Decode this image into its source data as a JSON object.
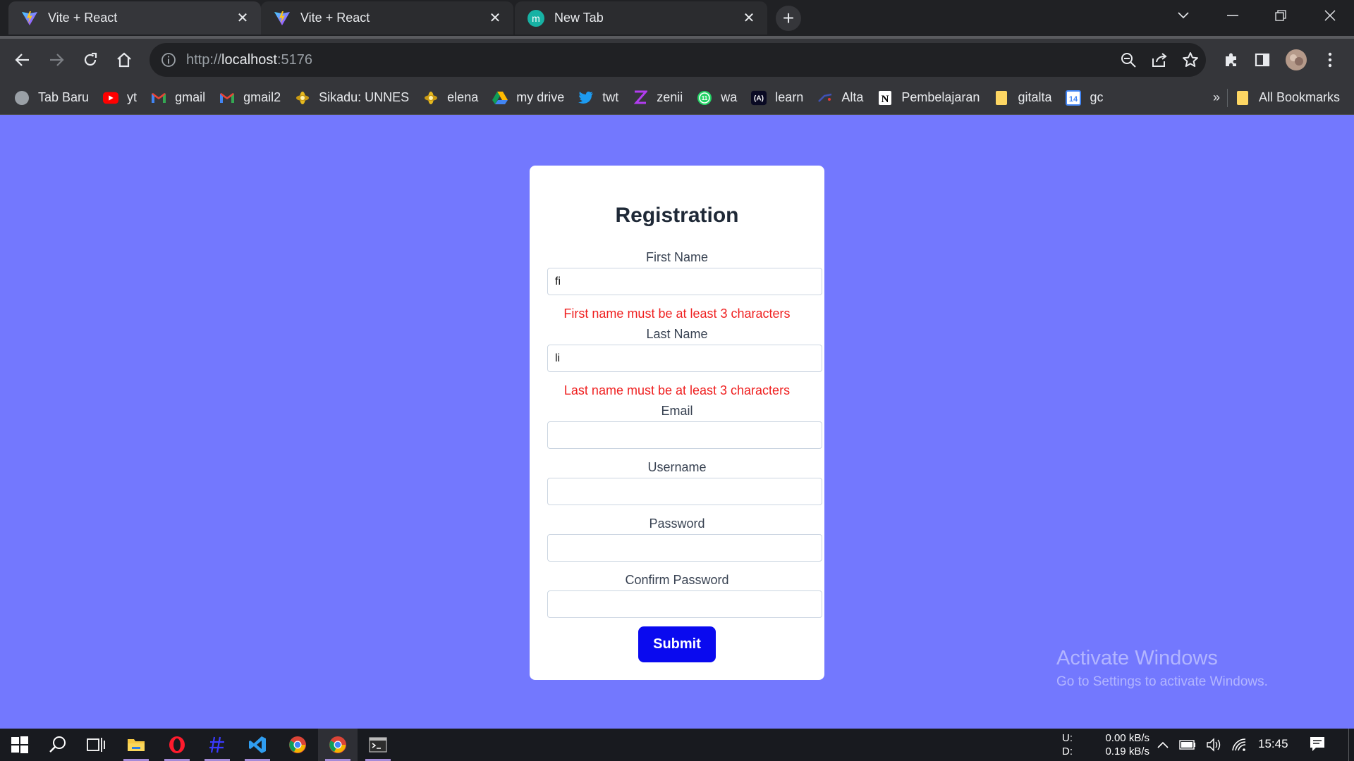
{
  "browser": {
    "tabs": [
      {
        "title": "Vite + React",
        "active": true
      },
      {
        "title": "Vite + React",
        "active": false
      },
      {
        "title": "New Tab",
        "active": false
      }
    ],
    "address": {
      "scheme": "http://",
      "host": "localhost",
      "port": ":5176"
    },
    "bookmarks": [
      {
        "label": "Tab Baru",
        "icon": "globe-icon"
      },
      {
        "label": "yt",
        "icon": "youtube-icon"
      },
      {
        "label": "gmail",
        "icon": "gmail-icon"
      },
      {
        "label": "gmail2",
        "icon": "gmail-icon"
      },
      {
        "label": "Sikadu: UNNES",
        "icon": "unnes-icon"
      },
      {
        "label": "elena",
        "icon": "unnes-icon"
      },
      {
        "label": "my drive",
        "icon": "drive-icon"
      },
      {
        "label": "twt",
        "icon": "twitter-icon"
      },
      {
        "label": "zenii",
        "icon": "z-icon"
      },
      {
        "label": "wa",
        "icon": "whatsapp-icon"
      },
      {
        "label": "learn",
        "icon": "learn-icon"
      },
      {
        "label": "Alta",
        "icon": "alta-icon"
      },
      {
        "label": "Pembelajaran",
        "icon": "notion-icon"
      },
      {
        "label": "gitalta",
        "icon": "folder-icon"
      },
      {
        "label": "gc",
        "icon": "calendar-icon"
      }
    ],
    "more_bookmarks": "»",
    "all_bookmarks": "All Bookmarks"
  },
  "form": {
    "title": "Registration",
    "first_name": {
      "label": "First Name",
      "value": "fi",
      "error": "First name must be at least 3 characters"
    },
    "last_name": {
      "label": "Last Name",
      "value": "li",
      "error": "Last name must be at least 3 characters"
    },
    "email": {
      "label": "Email",
      "value": ""
    },
    "username": {
      "label": "Username",
      "value": ""
    },
    "password": {
      "label": "Password",
      "value": ""
    },
    "confirm_password": {
      "label": "Confirm Password",
      "value": ""
    },
    "submit_label": "Submit"
  },
  "watermark": {
    "line1": "Activate Windows",
    "line2": "Go to Settings to activate Windows."
  },
  "taskbar": {
    "net_up_label": "U:",
    "net_down_label": "D:",
    "net_up": "0.00 kB/s",
    "net_down": "0.19 kB/s",
    "clock": "15:45"
  },
  "colors": {
    "page_background": "#7378fe",
    "submit_button": "#0a0aef",
    "error_text": "#ef1f1f"
  }
}
